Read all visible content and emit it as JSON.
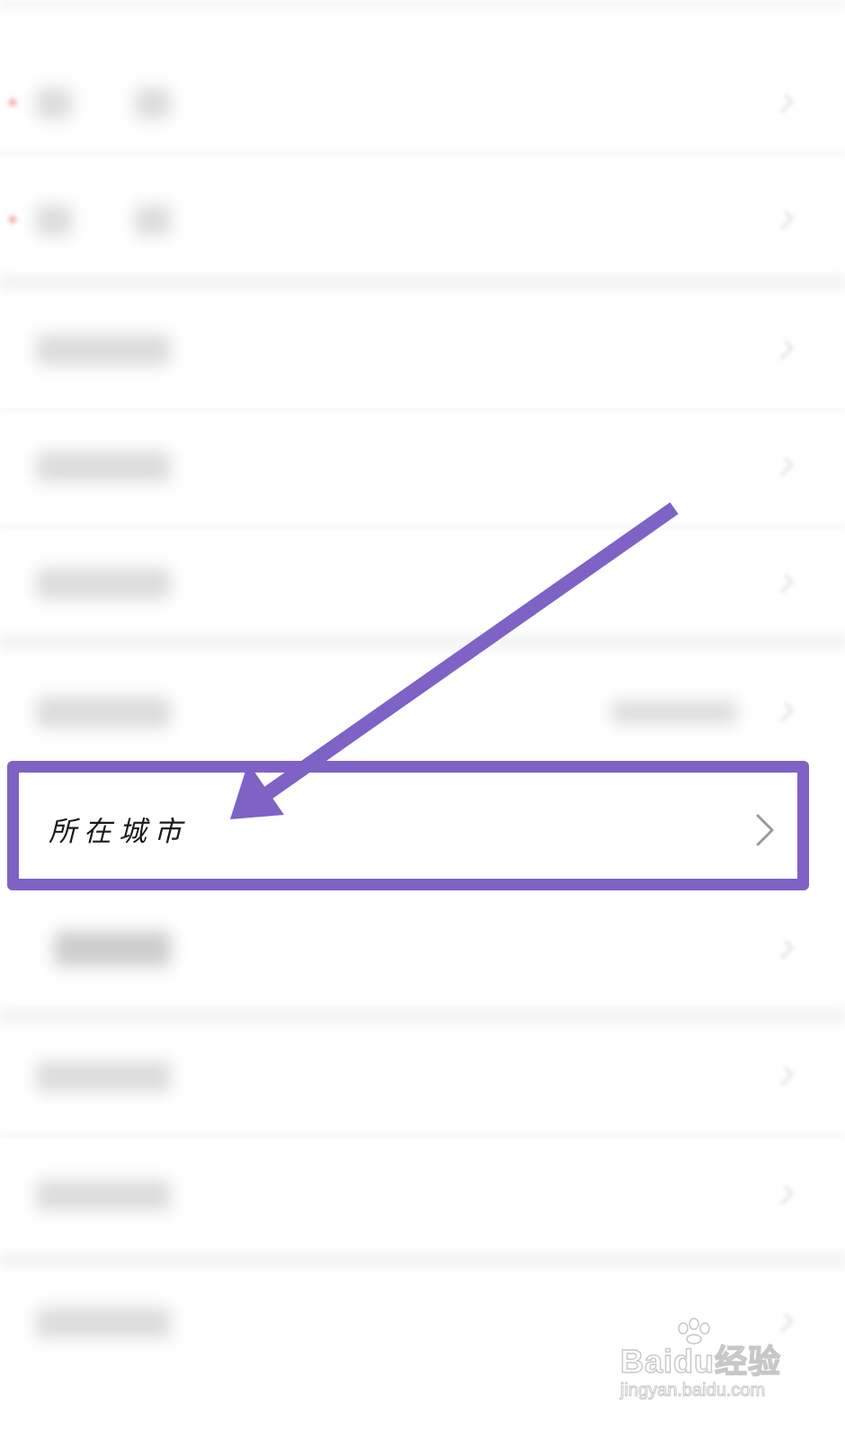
{
  "settings_list": {
    "highlighted_row": {
      "label": "所在城市"
    }
  },
  "annotation": {
    "arrow_color": "#7e62c6",
    "box_color": "#7e62c6"
  },
  "watermark": {
    "brand": "Baidu经验",
    "url": "jingyan.baidu.com"
  }
}
